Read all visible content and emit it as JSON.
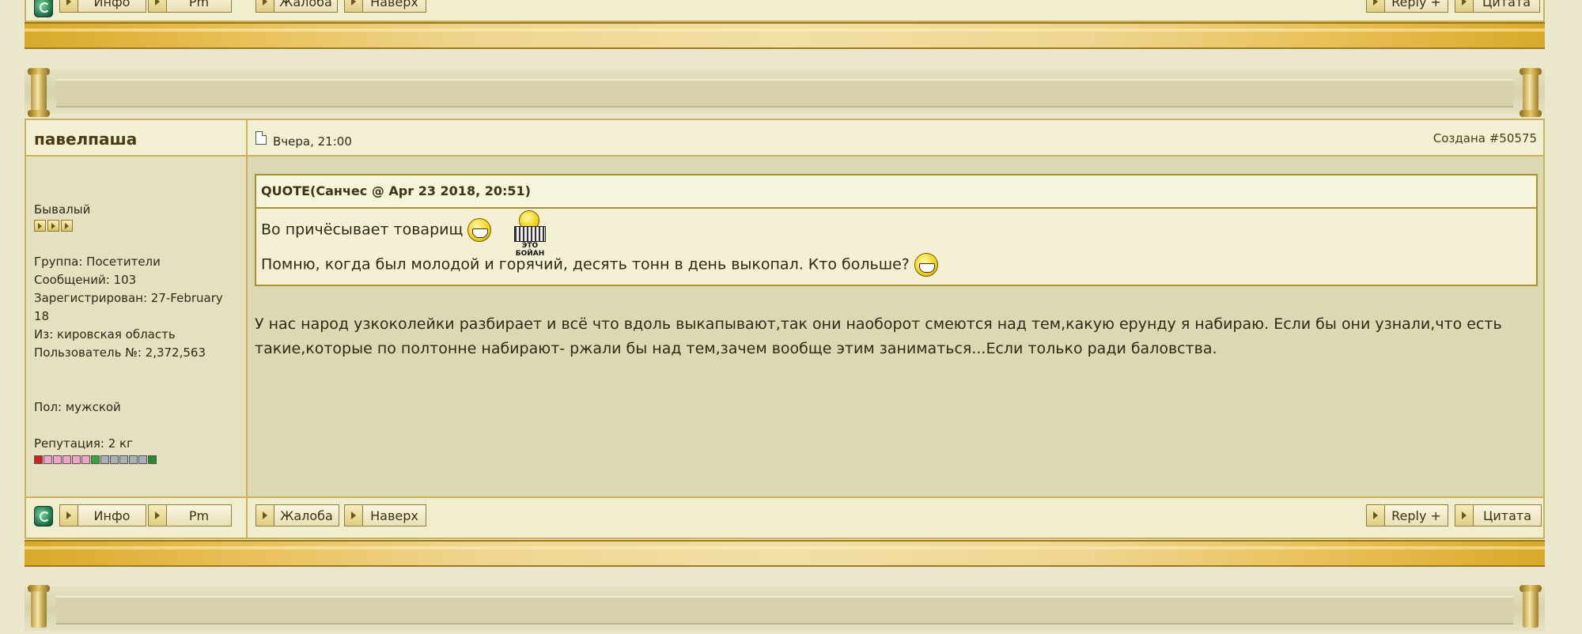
{
  "prev_post_footer": {
    "info": "Инфо",
    "pm": "Pm",
    "complaint": "Жалоба",
    "up": "Наверх",
    "reply": "Reply +",
    "quote": "Цитата"
  },
  "post": {
    "username": "павелпаша",
    "date": "Вчера, 21:00",
    "post_id_label": "Создана #50575",
    "author": {
      "rank": "Бывалый",
      "group": "Группа: Посетители",
      "messages": "Сообщений: 103",
      "registered_line1": "Зарегистрирован: 27-February",
      "registered_line2": "18",
      "from": "Из: кировская область",
      "user_no": "Пользователь №: 2,372,563",
      "gender": "Пол: мужской",
      "reputation": "Репутация: 2 кг",
      "rank_pips": 3,
      "reputation_fill": 2
    },
    "quote": {
      "header": "QUOTE(Санчес @ Apr 23 2018, 20:51)",
      "line1": "Во причёсывает товарищ",
      "boyan_caption": "ЭТО БОЙАН",
      "line2": "Помню, когда был молодой и горячий, десять тонн в день выкопал. Кто больше?"
    },
    "body": "У нас народ узкоколейки разбирает и всё что вдоль выкапывают,так они наоборот смеются над тем,какую ерунду я набираю. Если бы они узнали,что есть такие,которые по полтонне набирают- ржали бы над тем,зачем вообще этим заниматься...Если только ради баловства.",
    "footer": {
      "info": "Инфо",
      "pm": "Pm",
      "complaint": "Жалоба",
      "up": "Наверх",
      "reply": "Reply +",
      "quote": "Цитата"
    }
  },
  "colors": {
    "page_bg": "#ebe7cd",
    "gold_accent": "#d9a928",
    "border": "#c9b25b"
  }
}
